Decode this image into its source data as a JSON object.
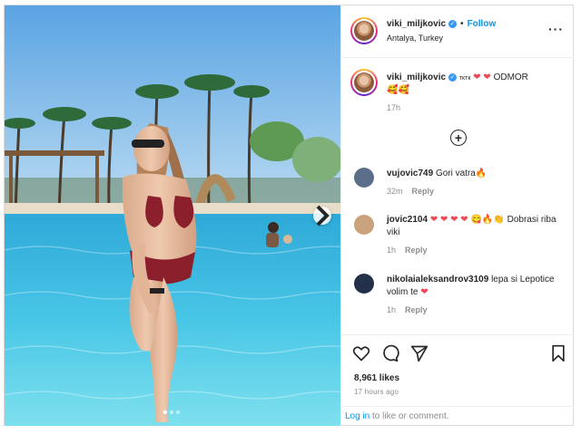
{
  "post": {
    "author": {
      "username": "viki_miljkovic",
      "location": "Antalya, Turkey",
      "follow_label": "Follow",
      "separator": "•"
    },
    "caption": {
      "username": "viki_miljkovic",
      "text_small": "тктк",
      "hearts": "❤ ❤",
      "text": "ODMOR",
      "emojis": "🥰🥰",
      "age": "17h"
    },
    "comments": [
      {
        "username": "vujovic749",
        "text": "Gori vatra🔥",
        "age": "32m",
        "reply_label": "Reply",
        "avatar_color": "#5b6f8a"
      },
      {
        "username": "jovic2104",
        "hearts": "❤ ❤ ❤ ❤",
        "emojis": "😋🔥👏",
        "text": "Dobrasi riba viki",
        "age": "1h",
        "reply_label": "Reply",
        "avatar_color": "#c9a27e"
      },
      {
        "username": "nikolaialeksandrov3109",
        "text": "lepa si Lepotice volim te",
        "heart": "❤",
        "age": "1h",
        "reply_label": "Reply",
        "avatar_color": "#22304a"
      }
    ],
    "likes": "8,961 likes",
    "posted": "17 hours ago",
    "login_link": "Log in",
    "login_rest": "to like or comment.",
    "icons": {
      "more": "more-options-icon",
      "add": "add-comment-plus-icon",
      "like": "heart-icon",
      "comment": "comment-bubble-icon",
      "share": "paper-plane-icon",
      "save": "bookmark-icon",
      "next": "chevron-right-icon"
    },
    "carousel": {
      "count": 3,
      "active": 1
    },
    "colors": {
      "accent": "#0095f6",
      "verified": "#3897f0",
      "heart": "#ed4956",
      "pool": "#3fc1e6",
      "sky": "#6fb0e8"
    }
  }
}
